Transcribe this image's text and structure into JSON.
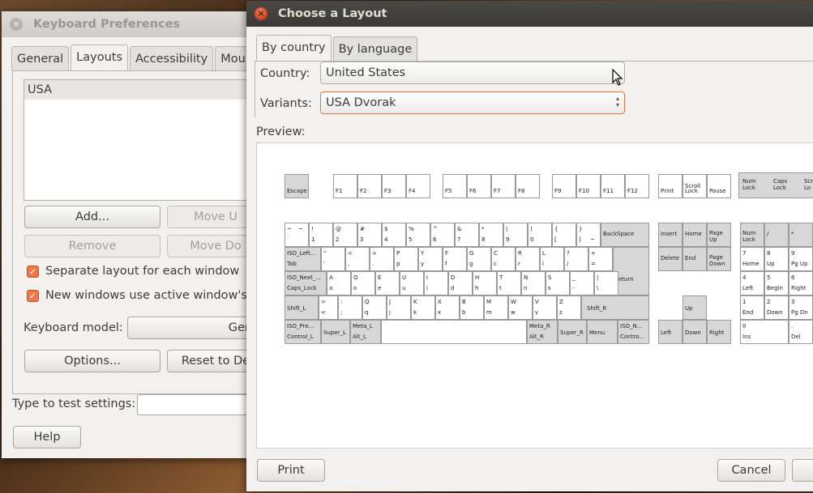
{
  "keyboard_prefs": {
    "title": "Keyboard Preferences",
    "tabs": [
      "General",
      "Layouts",
      "Accessibility",
      "Mouse K"
    ],
    "layouts_list": [
      "USA"
    ],
    "add_label": "Add...",
    "move_up_label": "Move U",
    "remove_label": "Remove",
    "move_down_label": "Move Do",
    "separate_layout_label": "Separate layout for each window",
    "new_windows_label": "New windows use active window's lay",
    "keyboard_model_label": "Keyboard model:",
    "generic_label": "Gene",
    "options_label": "Options...",
    "reset_label": "Reset to De",
    "test_label": "Type to test settings:",
    "help_label": "Help"
  },
  "layout_dialog": {
    "title": "Choose a Layout",
    "tabs": [
      "By country",
      "By language"
    ],
    "country_label": "Country:",
    "country_value": "United States",
    "variants_label": "Variants:",
    "variants_value": "USA Dvorak",
    "preview_label": "Preview:",
    "print_label": "Print",
    "cancel_label": "Cancel"
  },
  "preview_keys": {
    "escape": "Escape",
    "f1": "F1",
    "f2": "F2",
    "f3": "F3",
    "f4": "F4",
    "f5": "F5",
    "f6": "F6",
    "f7": "F7",
    "f8": "F8",
    "f9": "F9",
    "f10": "F10",
    "f11": "F11",
    "f12": "F12",
    "print": "Print",
    "scroll_a": "Scroll",
    "scroll_b": "Lock",
    "pause": "Pause",
    "num_a": "Num",
    "num_b": "Lock",
    "caps_a": "Caps",
    "caps_b": "Lock",
    "scro_a": "Scro",
    "scro_b": "Lo",
    "row1": [
      [
        "~",
        "`"
      ],
      [
        "!",
        "1"
      ],
      [
        "@",
        "2"
      ],
      [
        "#",
        "3"
      ],
      [
        "$",
        "4"
      ],
      [
        "%",
        "5"
      ],
      [
        "^",
        "6"
      ],
      [
        "&",
        "7"
      ],
      [
        "*",
        "8"
      ],
      [
        "(",
        "9"
      ],
      [
        ")",
        "0"
      ],
      [
        "{",
        "["
      ],
      [
        "}",
        "]"
      ]
    ],
    "row1_extra": "~",
    "backspace": "BackSpace",
    "insert": "Insert",
    "home": "Home",
    "pgup_a": "Page",
    "pgup_b": "Up",
    "numlock_a": "Num",
    "numlock_b": "Lock",
    "kp_div": "/",
    "kp_mul": "*",
    "tab_a": "ISO_Left...",
    "tab_b": "Tab",
    "row2": [
      [
        "\"",
        "'"
      ],
      [
        "<",
        ","
      ],
      [
        ">",
        "."
      ],
      [
        "P",
        "p"
      ],
      [
        "Y",
        "y"
      ],
      [
        "F",
        "f"
      ],
      [
        "G",
        "g"
      ],
      [
        "C",
        "c"
      ],
      [
        "R",
        "r"
      ],
      [
        "L",
        "l"
      ],
      [
        "?",
        "/"
      ],
      [
        "+",
        "="
      ]
    ],
    "delete": "Delete",
    "end": "End",
    "pgdn_a": "Page",
    "pgdn_b": "Down",
    "kp7_a": "7",
    "kp7_b": "Home",
    "kp8_a": "8",
    "kp8_b": "Up",
    "kp9_a": "9",
    "kp9_b": "Pg Up",
    "caps_key_a": "ISO_Next_...",
    "caps_key_b": "Caps_Lock",
    "row3": [
      [
        "A",
        "a"
      ],
      [
        "O",
        "o"
      ],
      [
        "E",
        "e"
      ],
      [
        "U",
        "u"
      ],
      [
        "I",
        "i"
      ],
      [
        "D",
        "d"
      ],
      [
        "H",
        "h"
      ],
      [
        "T",
        "t"
      ],
      [
        "N",
        "n"
      ],
      [
        "S",
        "s"
      ],
      [
        "_",
        "-"
      ],
      [
        "|",
        "\\"
      ]
    ],
    "return": "eturn",
    "kp4_a": "4",
    "kp4_b": "Left",
    "kp5_a": "5",
    "kp5_b": "Begin",
    "kp6_a": "6",
    "kp6_b": "Right",
    "shift_l": "Shift_L",
    "row4": [
      [
        ">",
        "<",
        "|"
      ],
      [
        ":",
        ";"
      ],
      [
        "Q",
        "q"
      ],
      [
        "J",
        "j"
      ],
      [
        "K",
        "k"
      ],
      [
        "X",
        "x"
      ],
      [
        "B",
        "b"
      ],
      [
        "M",
        "m"
      ],
      [
        "W",
        "w"
      ],
      [
        "V",
        "v"
      ],
      [
        "Z",
        "z"
      ]
    ],
    "shift_r": "Shift_R",
    "up": "Up",
    "kp1_a": "1",
    "kp1_b": "End",
    "kp2_a": "2",
    "kp2_b": "Down",
    "kp3_a": "3",
    "kp3_b": "Pg Dn",
    "ctrl_l_a": "ISO_Pre...",
    "ctrl_l_b": "Control_L",
    "super_l": "Super_L",
    "alt_l_a": "Meta_L",
    "alt_l_b": "Alt_L",
    "alt_r_a": "Meta_R",
    "alt_r_b": "Alt_R",
    "super_r": "Super_R",
    "menu": "Menu",
    "ctrl_r_a": "ISO_N...",
    "ctrl_r_b": "Contro...",
    "left": "Left",
    "down": "Down",
    "right": "Right",
    "kp0_a": "0",
    "kp0_b": "Ins",
    "kpdot_a": ".",
    "kpdot_b": "Del"
  }
}
